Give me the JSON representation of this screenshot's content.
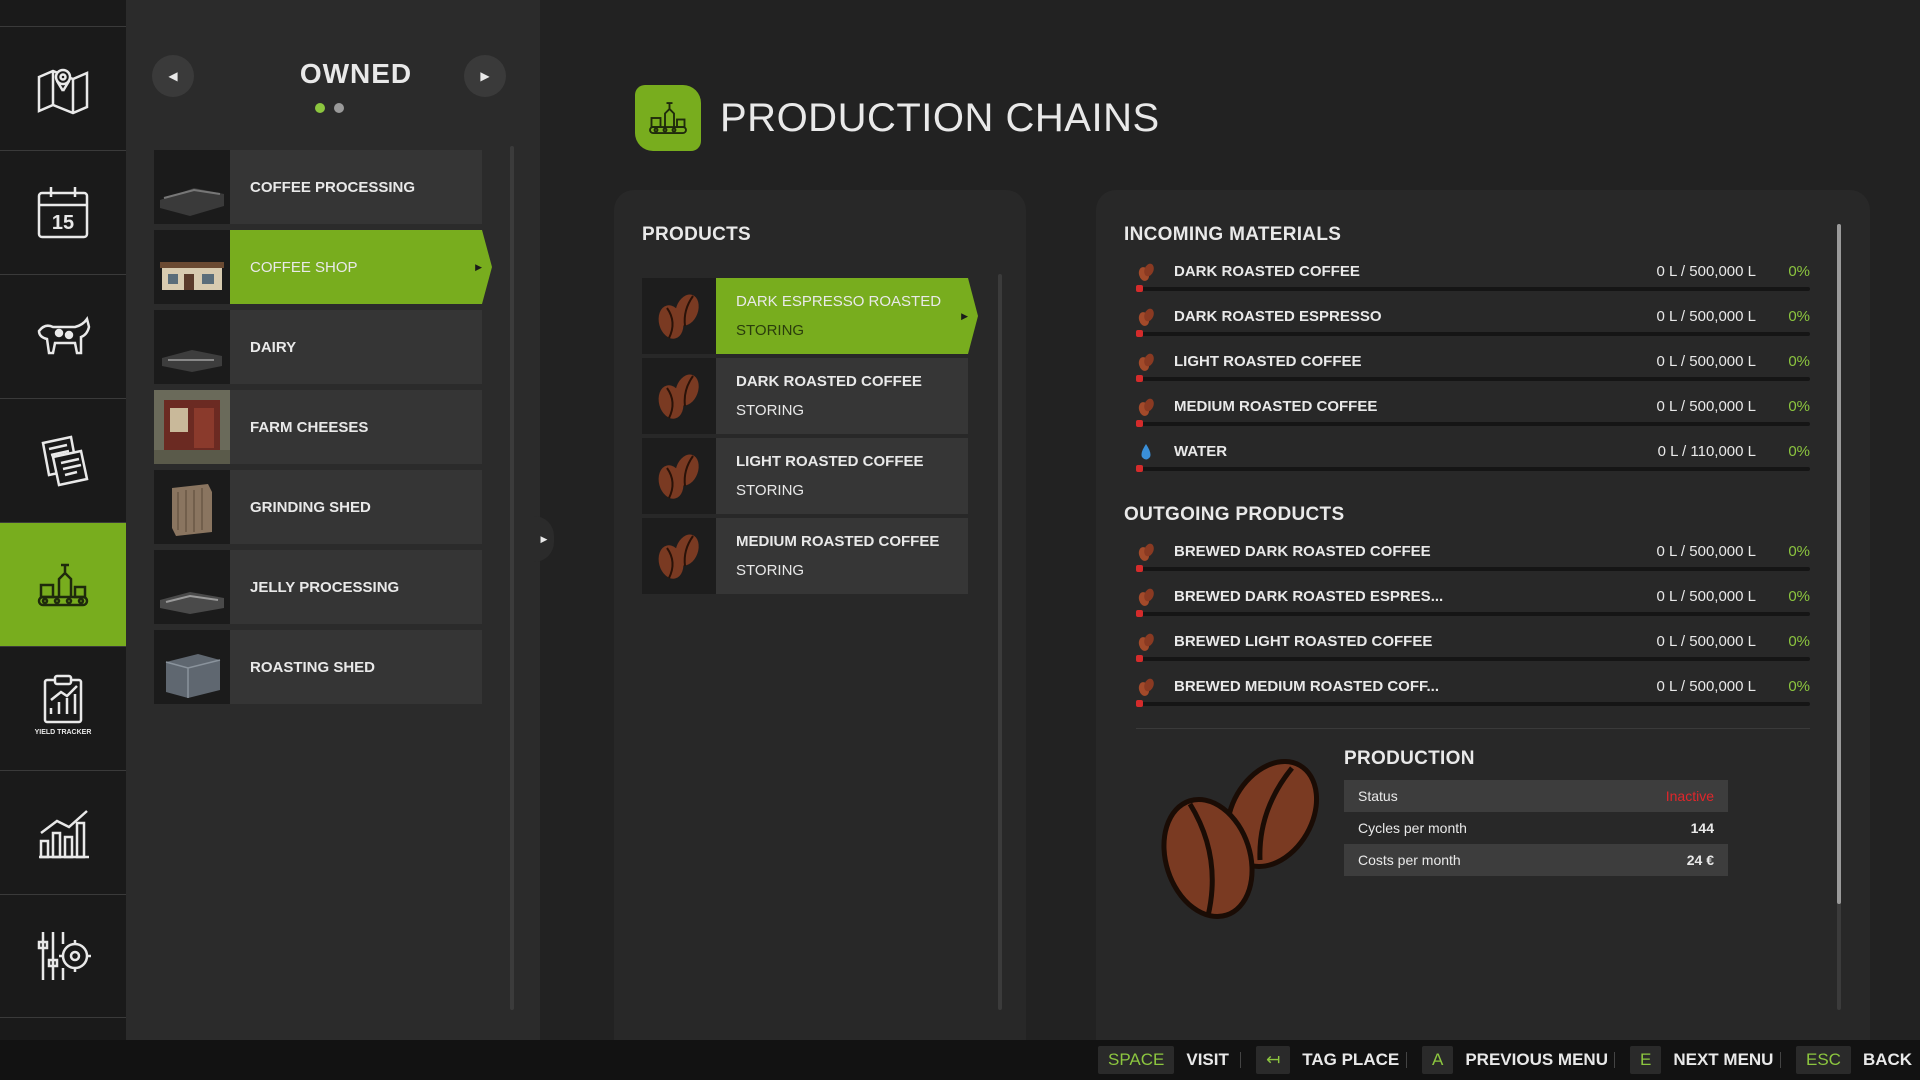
{
  "rail": {
    "items": [
      {
        "icon": "map-icon"
      },
      {
        "icon": "calendar-icon",
        "day": "15"
      },
      {
        "icon": "animals-icon"
      },
      {
        "icon": "contracts-icon"
      },
      {
        "icon": "production-icon",
        "active": true
      },
      {
        "icon": "yield-tracker-icon",
        "caption": "YIELD TRACKER"
      },
      {
        "icon": "statistics-icon"
      },
      {
        "icon": "settings-icon"
      }
    ]
  },
  "owned": {
    "title": "OWNED",
    "prev_label": "◀",
    "next_label": "▶",
    "page_count": 2,
    "current_page": 1,
    "places": [
      {
        "label": "COFFEE PROCESSING"
      },
      {
        "label": "COFFEE SHOP",
        "selected": true
      },
      {
        "label": "DAIRY"
      },
      {
        "label": "FARM CHEESES"
      },
      {
        "label": "GRINDING SHED"
      },
      {
        "label": "JELLY PROCESSING"
      },
      {
        "label": "ROASTING SHED"
      }
    ]
  },
  "header": {
    "title": "PRODUCTION CHAINS"
  },
  "products": {
    "title": "PRODUCTS",
    "items": [
      {
        "name": "DARK ESPRESSO ROASTED",
        "state": "STORING",
        "selected": true
      },
      {
        "name": "DARK ROASTED COFFEE",
        "state": "STORING"
      },
      {
        "name": "LIGHT ROASTED COFFEE",
        "state": "STORING"
      },
      {
        "name": "MEDIUM ROASTED COFFEE",
        "state": "STORING"
      }
    ]
  },
  "incoming": {
    "title": "INCOMING MATERIALS",
    "rows": [
      {
        "name": "DARK ROASTED COFFEE",
        "qty": "0 L / 500,000 L",
        "pct": "0%",
        "icon": "coffee-bean-icon",
        "fill": 0
      },
      {
        "name": "DARK ROASTED ESPRESSO",
        "qty": "0 L / 500,000 L",
        "pct": "0%",
        "icon": "coffee-bean-icon",
        "fill": 0
      },
      {
        "name": "LIGHT ROASTED COFFEE",
        "qty": "0 L / 500,000 L",
        "pct": "0%",
        "icon": "coffee-bean-icon",
        "fill": 0
      },
      {
        "name": "MEDIUM ROASTED COFFEE",
        "qty": "0 L / 500,000 L",
        "pct": "0%",
        "icon": "coffee-bean-icon",
        "fill": 0
      },
      {
        "name": "WATER",
        "qty": "0 L / 110,000 L",
        "pct": "0%",
        "icon": "water-drop-icon",
        "fill": 0
      }
    ]
  },
  "outgoing": {
    "title": "OUTGOING PRODUCTS",
    "rows": [
      {
        "name": "BREWED DARK ROASTED COFFEE",
        "qty": "0 L / 500,000 L",
        "pct": "0%",
        "icon": "coffee-bean-icon",
        "fill": 0
      },
      {
        "name": "BREWED DARK ROASTED ESPRES...",
        "qty": "0 L / 500,000 L",
        "pct": "0%",
        "icon": "coffee-bean-icon",
        "fill": 0
      },
      {
        "name": "BREWED LIGHT ROASTED COFFEE",
        "qty": "0 L / 500,000 L",
        "pct": "0%",
        "icon": "coffee-bean-icon",
        "fill": 0
      },
      {
        "name": "BREWED MEDIUM ROASTED COFF...",
        "qty": "0 L / 500,000 L",
        "pct": "0%",
        "icon": "coffee-bean-icon",
        "fill": 0
      }
    ]
  },
  "production": {
    "title": "PRODUCTION",
    "status_label": "Status",
    "status_value": "Inactive",
    "cycles_label": "Cycles per month",
    "cycles_value": "144",
    "costs_label": "Costs per month",
    "costs_value": "24 €"
  },
  "bottom_bar": {
    "hints": [
      {
        "key": "SPACE",
        "label": "VISIT"
      },
      {
        "key": "↤",
        "label": "TAG PLACE"
      },
      {
        "key": "A",
        "label": "PREVIOUS MENU"
      },
      {
        "key": "E",
        "label": "NEXT MENU"
      },
      {
        "key": "ESC",
        "label": "BACK"
      }
    ]
  },
  "colors": {
    "accent": "#78ad1e",
    "accent_text": "#8cc63f",
    "inactive": "#e0262b",
    "bar_empty_marker": "#d42b2b"
  }
}
